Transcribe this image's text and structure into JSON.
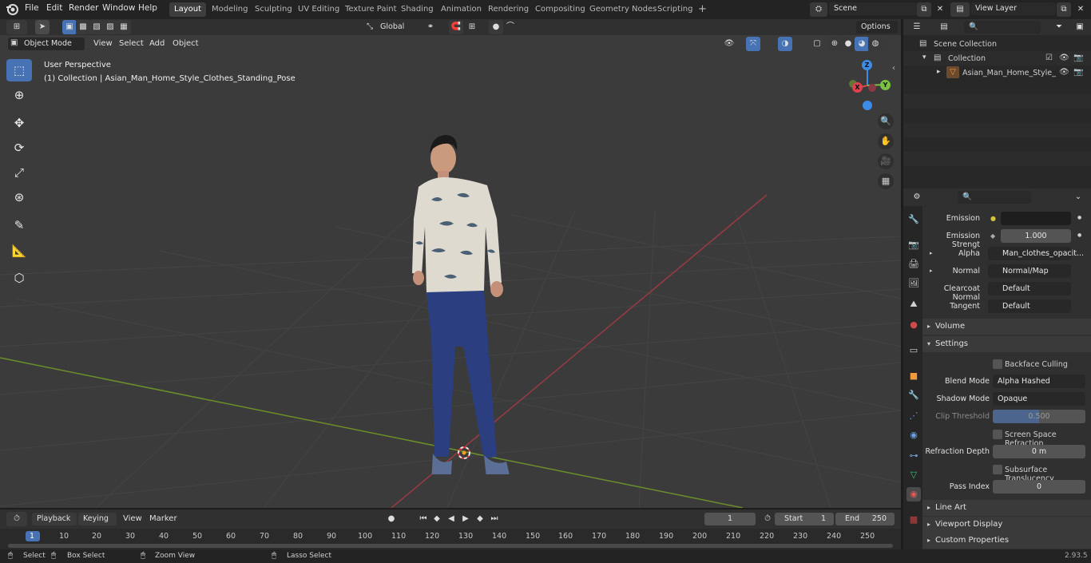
{
  "menu": {
    "file": "File",
    "edit": "Edit",
    "render": "Render",
    "window": "Window",
    "help": "Help"
  },
  "workspaces": [
    "Layout",
    "Modeling",
    "Sculpting",
    "UV Editing",
    "Texture Paint",
    "Shading",
    "Animation",
    "Rendering",
    "Compositing",
    "Geometry Nodes",
    "Scripting"
  ],
  "add_workspace": "+",
  "scene": {
    "label": "Scene",
    "view_layer": "View Layer"
  },
  "viewport_header": {
    "mode": "Object Mode",
    "view": "View",
    "select": "Select",
    "add": "Add",
    "object": "Object",
    "orientation": "Global",
    "options": "Options"
  },
  "viewport": {
    "perspective": "User Perspective",
    "object_info": "(1) Collection | Asian_Man_Home_Style_Clothes_Standing_Pose"
  },
  "gizmo": {
    "x": "X",
    "y": "Y",
    "z": "Z"
  },
  "outliner": {
    "scene_collection": "Scene Collection",
    "collection": "Collection",
    "object": "Asian_Man_Home_Style_"
  },
  "properties": {
    "emission": "Emission",
    "emission_strength_label": "Emission Strengt",
    "emission_strength": "1.000",
    "alpha_label": "Alpha",
    "alpha_value": "Man_clothes_opacit...",
    "normal_label": "Normal",
    "normal_value": "Normal/Map",
    "clearcoat_label": "Clearcoat Normal",
    "clearcoat_value": "Default",
    "tangent_label": "Tangent",
    "tangent_value": "Default",
    "volume": "Volume",
    "settings": "Settings",
    "backface": "Backface Culling",
    "blend_mode_label": "Blend Mode",
    "blend_mode": "Alpha Hashed",
    "shadow_mode_label": "Shadow Mode",
    "shadow_mode": "Opaque",
    "clip_label": "Clip Threshold",
    "clip_value": "0.500",
    "ssr": "Screen Space Refraction",
    "refraction_label": "Refraction Depth",
    "refraction_value": "0 m",
    "subsurface": "Subsurface Translucency",
    "pass_label": "Pass Index",
    "pass_value": "0",
    "line_art": "Line Art",
    "viewport_display": "Viewport Display",
    "custom_props": "Custom Properties"
  },
  "timeline": {
    "playback": "Playback",
    "keying": "Keying",
    "view": "View",
    "marker": "Marker",
    "current_frame": "1",
    "start_label": "Start",
    "start": "1",
    "end_label": "End",
    "end": "250",
    "ticks": [
      "1",
      "10",
      "20",
      "30",
      "40",
      "50",
      "60",
      "70",
      "80",
      "90",
      "100",
      "110",
      "120",
      "130",
      "140",
      "150",
      "160",
      "170",
      "180",
      "190",
      "200",
      "210",
      "220",
      "230",
      "240",
      "250"
    ]
  },
  "status": {
    "select": "Select",
    "box_select": "Box Select",
    "zoom_view": "Zoom View",
    "lasso_select": "Lasso Select",
    "version": "2.93.5"
  },
  "colors": {
    "accent": "#4772b3",
    "x_axis": "#e0414f",
    "y_axis": "#7ac143",
    "z_axis": "#3c8ce7"
  }
}
